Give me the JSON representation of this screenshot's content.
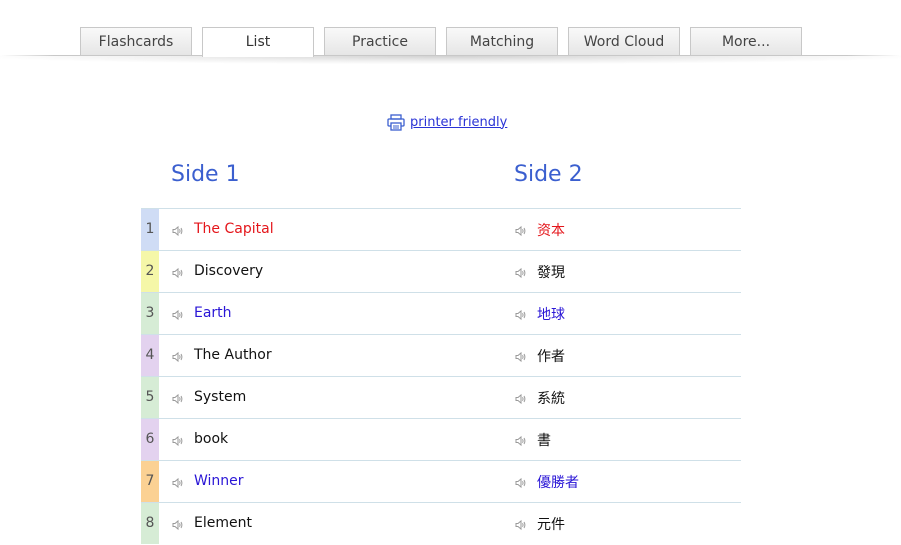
{
  "tabs": [
    {
      "label": "Flashcards",
      "active": false
    },
    {
      "label": "List",
      "active": true
    },
    {
      "label": "Practice",
      "active": false
    },
    {
      "label": "Matching",
      "active": false
    },
    {
      "label": "Word Cloud",
      "active": false
    },
    {
      "label": "More...",
      "active": false
    }
  ],
  "printer_link": {
    "label": "printer friendly",
    "icon": "printer-icon"
  },
  "columns": {
    "side1": "Side 1",
    "side2": "Side 2"
  },
  "rows": [
    {
      "num": "1",
      "term": "The Capital",
      "definition": "资本",
      "num_bg": "#cfdcf5",
      "text_color": "#e4161b"
    },
    {
      "num": "2",
      "term": "Discovery",
      "definition": "發現",
      "num_bg": "#f5f7a8",
      "text_color": "#111111"
    },
    {
      "num": "3",
      "term": "Earth",
      "definition": "地球",
      "num_bg": "#d6ecd5",
      "text_color": "#2a16d6"
    },
    {
      "num": "4",
      "term": "The Author",
      "definition": "作者",
      "num_bg": "#e3d2ef",
      "text_color": "#111111"
    },
    {
      "num": "5",
      "term": "System",
      "definition": "系統",
      "num_bg": "#d6ecd5",
      "text_color": "#111111"
    },
    {
      "num": "6",
      "term": "book",
      "definition": "書",
      "num_bg": "#e3d2ef",
      "text_color": "#111111"
    },
    {
      "num": "7",
      "term": "Winner",
      "definition": "優勝者",
      "num_bg": "#fbd193",
      "text_color": "#2a16d6"
    },
    {
      "num": "8",
      "term": "Element",
      "definition": "元件",
      "num_bg": "#d6ecd5",
      "text_color": "#111111"
    }
  ],
  "colors": {
    "header_blue": "#3b5fcf",
    "link_blue": "#2a33d6",
    "row_divider": "#cfe0e8",
    "speaker_gray": "#9a9a9a"
  },
  "icons": {
    "speaker": "speaker-icon"
  }
}
